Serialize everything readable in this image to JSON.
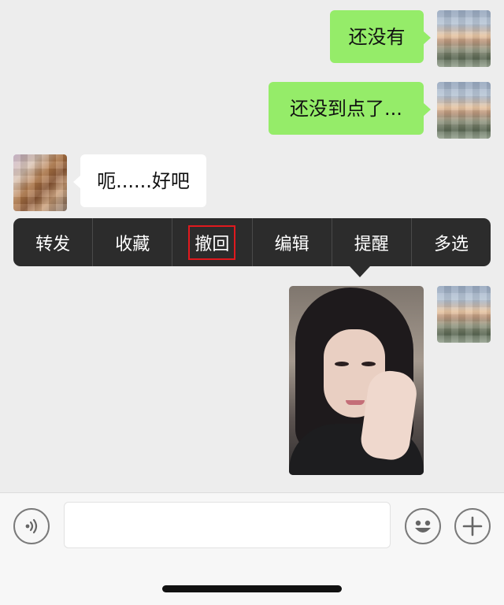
{
  "messages": [
    {
      "sender": "me",
      "text": "还没有"
    },
    {
      "sender": "me",
      "text": "还没到点了..."
    },
    {
      "sender": "other",
      "text": "呃......好吧"
    },
    {
      "sender": "me",
      "type": "image"
    }
  ],
  "context_menu": {
    "items": [
      "转发",
      "收藏",
      "撤回",
      "编辑",
      "提醒",
      "多选"
    ],
    "highlighted": "撤回"
  },
  "input": {
    "placeholder": "",
    "icons": [
      "voice-icon",
      "emoji-icon",
      "plus-icon"
    ]
  },
  "colors": {
    "background": "#ededed",
    "bubble_me": "#95ec69",
    "bubble_other": "#ffffff",
    "menu_bg": "#2c2c2c",
    "highlight_border": "#e0191e"
  }
}
